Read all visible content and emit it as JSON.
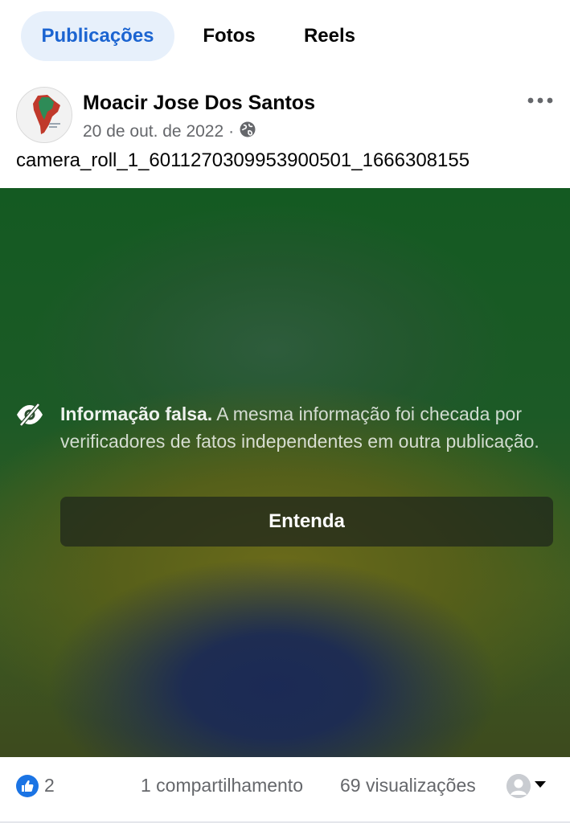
{
  "tabs": [
    {
      "label": "Publicações",
      "active": true
    },
    {
      "label": "Fotos",
      "active": false
    },
    {
      "label": "Reels",
      "active": false
    }
  ],
  "post": {
    "author": "Moacir Jose Dos Santos",
    "date": "20 de out. de 2022",
    "separator": "·",
    "privacy_icon": "globe-icon",
    "caption": "camera_roll_1_6011270309953900501_1666308155"
  },
  "warning": {
    "icon": "eye-slash-icon",
    "title": "Informação falsa.",
    "body": " A mesma informação foi checada por verificadores de fatos independentes em outra publicação.",
    "button_label": "Entenda"
  },
  "reactions": {
    "icon": "like-icon",
    "count": "2",
    "shares": "1 compartilhamento",
    "views": "69 visualizações"
  },
  "colors": {
    "accent": "#1b64d1",
    "active_tab_bg": "#e7f0fb",
    "like_blue": "#1b74e4",
    "secondary_text": "#65676b"
  }
}
